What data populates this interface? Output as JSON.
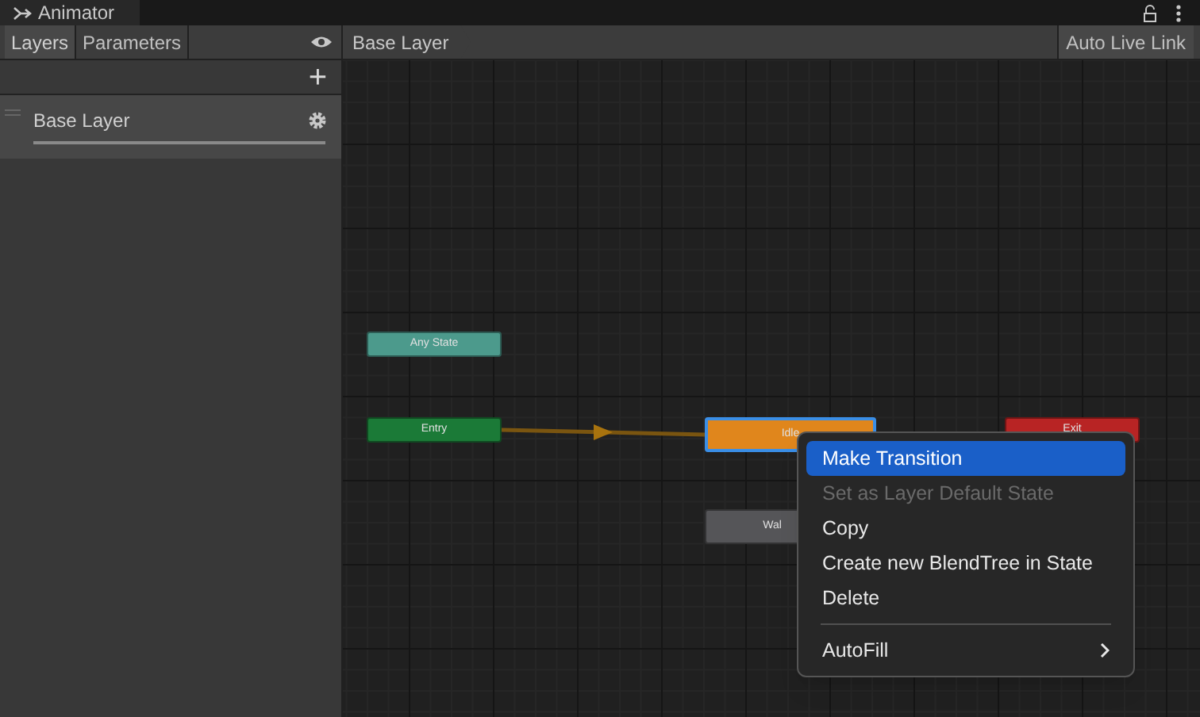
{
  "window": {
    "title": "Animator"
  },
  "tabs": [
    {
      "label": "Layers",
      "selected": true
    },
    {
      "label": "Parameters",
      "selected": false
    }
  ],
  "breadcrumb": "Base Layer",
  "auto_live_link": "Auto Live Link",
  "add_button": "+",
  "layers": [
    {
      "name": "Base Layer",
      "selected": true
    }
  ],
  "states": [
    {
      "label": "Any State",
      "color": "#4c9a8c",
      "selected": false
    },
    {
      "label": "Entry",
      "color": "#1b7a37",
      "selected": false
    },
    {
      "label": "Idle",
      "color": "#e0861c",
      "selected": true
    },
    {
      "label": "Exit",
      "color": "#b82424",
      "selected": false
    },
    {
      "label": "Wal",
      "color": "#555558",
      "selected": false
    }
  ],
  "context_menu": {
    "items": [
      {
        "kind": "item",
        "label": "Make Transition",
        "selected": true,
        "disabled": false
      },
      {
        "kind": "item",
        "label": "Set as Layer Default State",
        "selected": false,
        "disabled": true
      },
      {
        "kind": "item",
        "label": "Copy",
        "selected": false,
        "disabled": false
      },
      {
        "kind": "item",
        "label": "Create new BlendTree in State",
        "selected": false,
        "disabled": false
      },
      {
        "kind": "item",
        "label": "Delete",
        "selected": false,
        "disabled": false
      },
      {
        "kind": "separator"
      },
      {
        "kind": "submenu",
        "label": "AutoFill",
        "selected": false,
        "disabled": false
      }
    ]
  }
}
